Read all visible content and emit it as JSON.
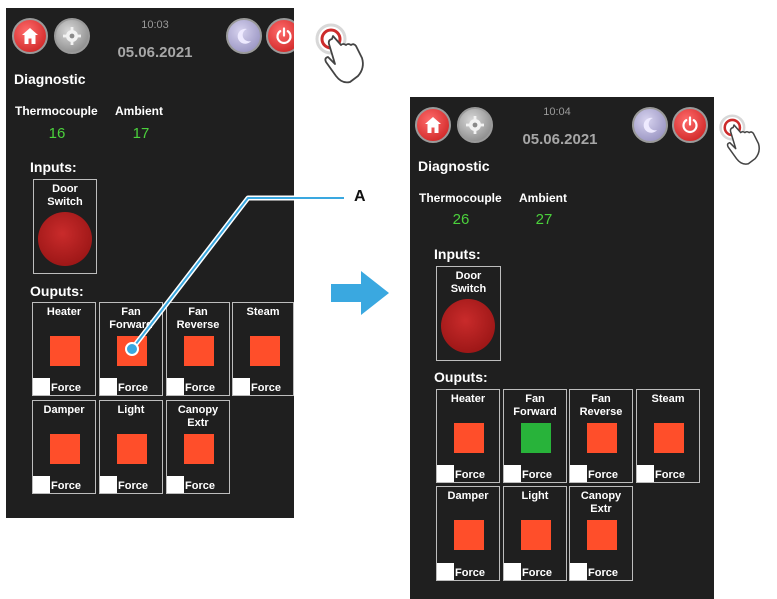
{
  "left": {
    "time": "10:03",
    "date": "05.06.2021",
    "title": "Diagnostic",
    "sensors": [
      {
        "label": "Thermocouple",
        "value": "16"
      },
      {
        "label": "Ambient",
        "value": "17"
      }
    ],
    "inputs_title": "Inputs:",
    "input": {
      "label_line1": "Door",
      "label_line2": "Switch"
    },
    "outputs_title": "Ouputs:",
    "outputs": [
      {
        "line1": "Heater",
        "line2": "",
        "force": "Force",
        "state": "off"
      },
      {
        "line1": "Fan",
        "line2": "Forward",
        "force": "Force",
        "state": "off"
      },
      {
        "line1": "Fan",
        "line2": "Reverse",
        "force": "Force",
        "state": "off"
      },
      {
        "line1": "Steam",
        "line2": "",
        "force": "Force",
        "state": "off"
      },
      {
        "line1": "Damper",
        "line2": "",
        "force": "Force",
        "state": "off"
      },
      {
        "line1": "Light",
        "line2": "",
        "force": "Force",
        "state": "off"
      },
      {
        "line1": "Canopy",
        "line2": "Extr",
        "force": "Force",
        "state": "off"
      }
    ]
  },
  "right": {
    "time": "10:04",
    "date": "05.06.2021",
    "title": "Diagnostic",
    "sensors": [
      {
        "label": "Thermocouple",
        "value": "26"
      },
      {
        "label": "Ambient",
        "value": "27"
      }
    ],
    "inputs_title": "Inputs:",
    "input": {
      "label_line1": "Door",
      "label_line2": "Switch"
    },
    "outputs_title": "Ouputs:",
    "outputs": [
      {
        "line1": "Heater",
        "line2": "",
        "force": "Force",
        "state": "off"
      },
      {
        "line1": "Fan",
        "line2": "Forward",
        "force": "Force",
        "state": "on"
      },
      {
        "line1": "Fan",
        "line2": "Reverse",
        "force": "Force",
        "state": "off"
      },
      {
        "line1": "Steam",
        "line2": "",
        "force": "Force",
        "state": "off"
      },
      {
        "line1": "Damper",
        "line2": "",
        "force": "Force",
        "state": "off"
      },
      {
        "line1": "Light",
        "line2": "",
        "force": "Force",
        "state": "off"
      },
      {
        "line1": "Canopy",
        "line2": "Extr",
        "force": "Force",
        "state": "off"
      }
    ]
  },
  "callout": {
    "label": "A"
  },
  "colors": {
    "panel_bg": "#1f1f1f",
    "sensor_value": "#4bd13c",
    "output_off": "#ff4e2a",
    "output_on": "#28b33a",
    "callout_line": "#3aa8e0",
    "arrow": "#3aa8e0"
  },
  "icons": [
    "home-icon",
    "gear-icon",
    "moon-icon",
    "power-icon",
    "touch-hand-icon",
    "arrow-right-icon"
  ]
}
